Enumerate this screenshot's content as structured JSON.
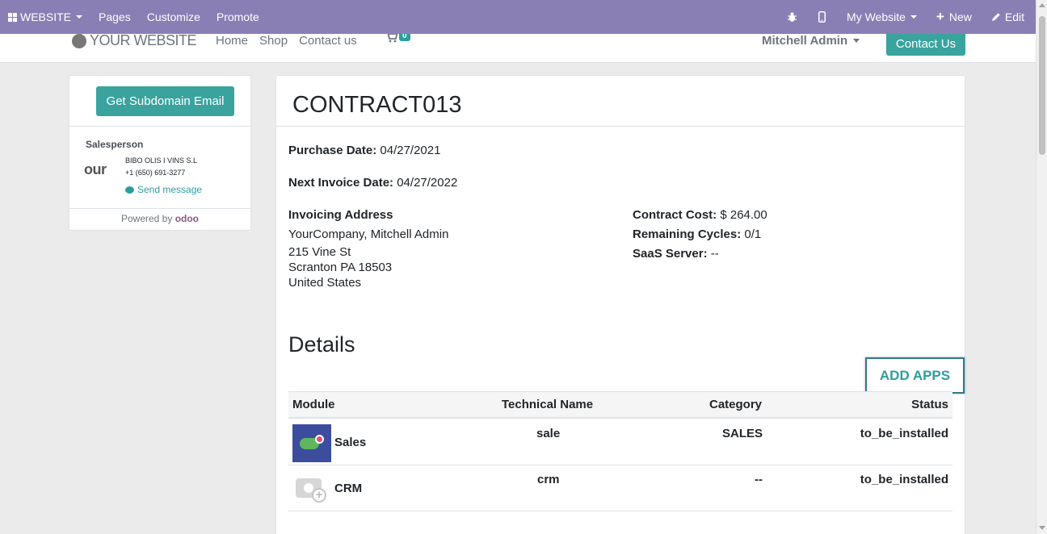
{
  "admin_bar": {
    "app_menu_label": "WEBSITE",
    "pages_label": "Pages",
    "customize_label": "Customize",
    "promote_label": "Promote",
    "website_switcher_label": "My Website",
    "new_label": "New",
    "edit_label": "Edit"
  },
  "site_header": {
    "logo_text": "YOUR WEBSITE",
    "nav": [
      "Home",
      "Shop",
      "Contact us"
    ],
    "cart_count": "0",
    "user_name": "Mitchell Admin",
    "contact_button": "Contact Us"
  },
  "sidebar": {
    "subdomain_button": "Get Subdomain Email",
    "salesperson_label": "Salesperson",
    "salesperson_avatar_text": "our C",
    "salesperson_name": "BIBO OLIS I VINS S.L",
    "salesperson_phone": "+1 (650) 691-3277",
    "send_message": "Send message",
    "powered_by": "Powered by",
    "powered_brand": "odoo"
  },
  "contract": {
    "title": "CONTRACT013",
    "purchase_date_label": "Purchase Date:",
    "purchase_date": "04/27/2021",
    "next_invoice_label": "Next Invoice Date:",
    "next_invoice_date": "04/27/2022",
    "invoicing_address_label": "Invoicing Address",
    "address_name": "YourCompany, Mitchell Admin",
    "address_street": "215 Vine St",
    "address_city": "Scranton PA 18503",
    "address_country": "United States",
    "contract_cost_label": "Contract Cost:",
    "contract_cost": "$ 264.00",
    "remaining_cycles_label": "Remaining Cycles:",
    "remaining_cycles": "0/1",
    "saas_server_label": "SaaS Server:",
    "saas_server": "--"
  },
  "details": {
    "title": "Details",
    "add_apps_button": "ADD APPS",
    "columns": [
      "Module",
      "Technical Name",
      "Category",
      "Status"
    ],
    "rows": [
      {
        "module": "Sales",
        "technical_name": "sale",
        "category": "SALES",
        "status": "to_be_installed",
        "icon": "sales-app-icon"
      },
      {
        "module": "CRM",
        "technical_name": "crm",
        "category": "--",
        "status": "to_be_installed",
        "icon": "crm-app-icon"
      }
    ]
  },
  "colors": {
    "admin_bar": "#8a7fb5",
    "primary": "#3aa39e",
    "background": "#ebebeb"
  }
}
